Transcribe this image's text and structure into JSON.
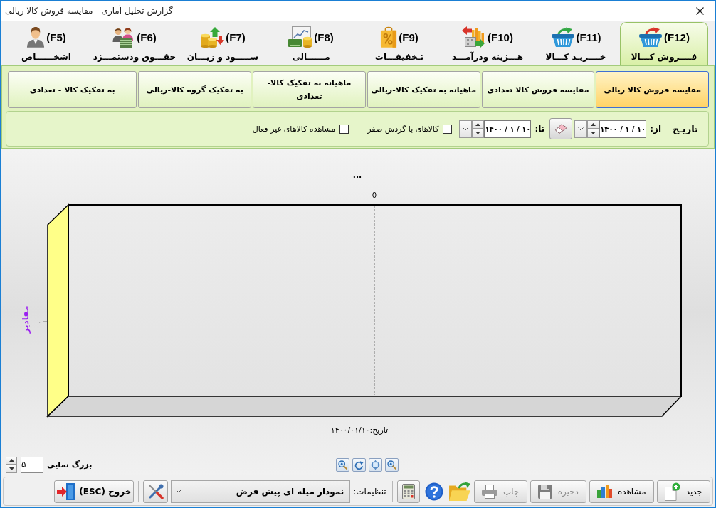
{
  "window": {
    "title": "گزارش تحلیل آماری - مقایسه فروش کالا ریالی"
  },
  "main_tabs": [
    {
      "key": "(F12)",
      "label": "فــــروش کـــالا",
      "selected": true
    },
    {
      "key": "(F11)",
      "label": "خــــریـد کـــالا",
      "selected": false
    },
    {
      "key": "(F10)",
      "label": "هـــزینه ودرآمـــد",
      "selected": false
    },
    {
      "key": "(F9)",
      "label": "تـخفیفـــات",
      "selected": false
    },
    {
      "key": "(F8)",
      "label": "مــــــالی",
      "selected": false
    },
    {
      "key": "(F7)",
      "label": "ســـــود و زیـــان",
      "selected": false
    },
    {
      "key": "(F6)",
      "label": "حقـــوق ودستمـــزد",
      "selected": false
    },
    {
      "key": "(F5)",
      "label": "اشخــــــاص",
      "selected": false
    }
  ],
  "report_tabs": [
    {
      "label": "مقایسه فروش کالا ریالی",
      "selected": true
    },
    {
      "label": "مقایسه فروش کالا تعدادی",
      "selected": false
    },
    {
      "label": "ماهیانه به تفکیک کالا-ریالی",
      "selected": false
    },
    {
      "label": "ماهیانه به تفکیک کالا-تعدادی",
      "selected": false
    },
    {
      "label": "به تفکیک گروه کالا-ریالی",
      "selected": false
    },
    {
      "label": "به تفکیک کالا - تعدادی",
      "selected": false
    }
  ],
  "filter": {
    "date_label": "تاریـخ",
    "from_label": "از:",
    "from_date": "۱۴۰۰ / ۱ / ۱۰",
    "to_label": "تا:",
    "to_date": "۱۴۰۰ / ۱ / ۱۰",
    "checkboxes": [
      {
        "label": "کالاهای با گردش صفر",
        "checked": false
      },
      {
        "label": "مشاهده کالاهای غیر فعال",
        "checked": false
      }
    ]
  },
  "chart": {
    "title": "...",
    "top_tick": "0",
    "ylabel": "مقادیر",
    "y_tick": "۰",
    "xlabel": "تاریخ:۱۴۰۰/۰۱/۱۰"
  },
  "zoom": {
    "label": "بزرگ نمایی",
    "value": "۵"
  },
  "toolbar": {
    "buttons": [
      {
        "label": "جدید",
        "disabled": false
      },
      {
        "label": "مشاهده",
        "disabled": false
      },
      {
        "label": "ذخیره",
        "disabled": true
      },
      {
        "label": "چاپ",
        "disabled": true
      }
    ],
    "settings_label": "تنظیمات:",
    "settings_value": "نمودار میله ای پیش فرض",
    "exit_label": "خروج (ESC)"
  }
}
